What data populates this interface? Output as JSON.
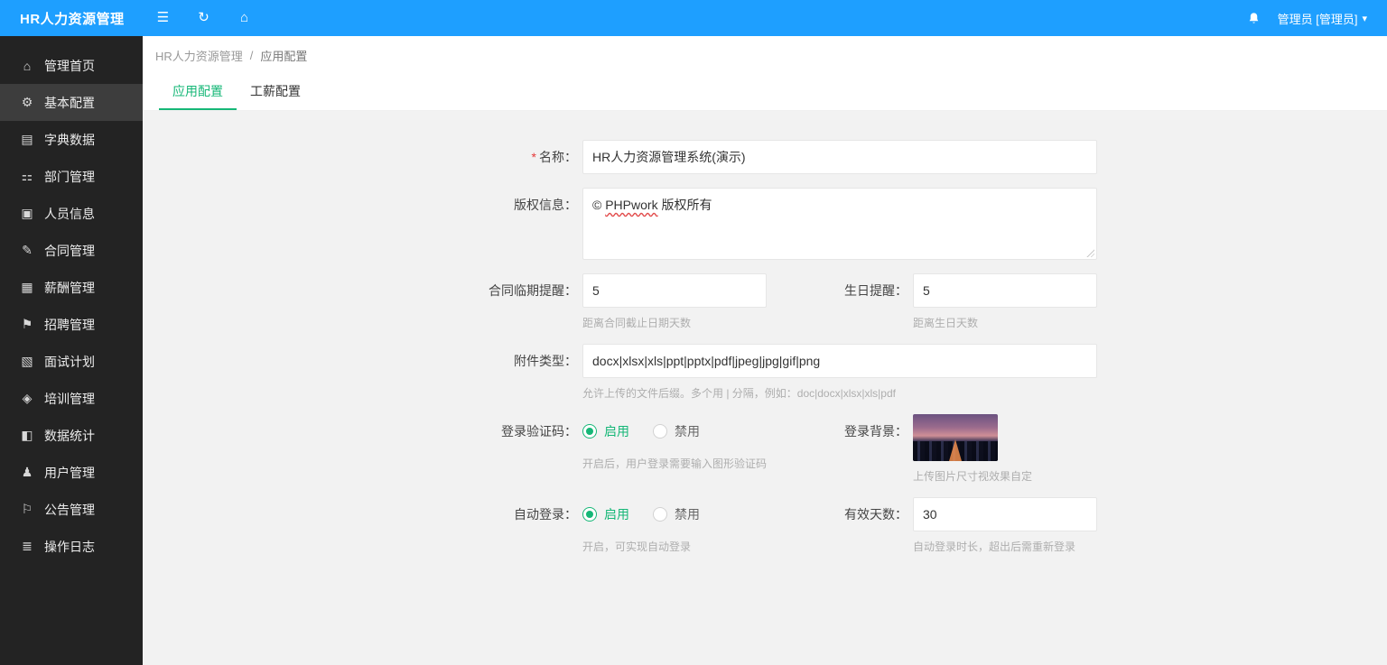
{
  "colors": {
    "primary": "#1e9fff",
    "accent_green": "#16b777",
    "sidebar_bg": "#232323",
    "sidebar_active": "#3d3d3d"
  },
  "header": {
    "title": "HR人力资源管理",
    "icons": {
      "collapse": "☰",
      "refresh": "↻",
      "home": "⌂",
      "caret": "▾"
    },
    "user_label": "管理员 [管理员]"
  },
  "sidebar": {
    "items": [
      {
        "label": "管理首页",
        "icon": "home-icon",
        "glyph": "⌂",
        "active": false
      },
      {
        "label": "基本配置",
        "icon": "settings-gear-icon",
        "glyph": "⚙",
        "active": true
      },
      {
        "label": "字典数据",
        "icon": "dictionary-book-icon",
        "glyph": "▤",
        "active": false
      },
      {
        "label": "部门管理",
        "icon": "department-sitemap-icon",
        "glyph": "⚏",
        "active": false
      },
      {
        "label": "人员信息",
        "icon": "personnel-idcard-icon",
        "glyph": "▣",
        "active": false
      },
      {
        "label": "合同管理",
        "icon": "contract-edit-icon",
        "glyph": "✎",
        "active": false
      },
      {
        "label": "薪酬管理",
        "icon": "salary-calculator-icon",
        "glyph": "▦",
        "active": false
      },
      {
        "label": "招聘管理",
        "icon": "recruitment-megaphone-icon",
        "glyph": "⚑",
        "active": false
      },
      {
        "label": "面试计划",
        "icon": "interview-file-icon",
        "glyph": "▧",
        "active": false
      },
      {
        "label": "培训管理",
        "icon": "training-icon",
        "glyph": "◈",
        "active": false
      },
      {
        "label": "数据统计",
        "icon": "statistics-chart-icon",
        "glyph": "◧",
        "active": false
      },
      {
        "label": "用户管理",
        "icon": "user-icon",
        "glyph": "♟",
        "active": false
      },
      {
        "label": "公告管理",
        "icon": "announcement-speaker-icon",
        "glyph": "⚐",
        "active": false
      },
      {
        "label": "操作日志",
        "icon": "logs-list-icon",
        "glyph": "≣",
        "active": false
      }
    ]
  },
  "breadcrumb": {
    "root": "HR人力资源管理",
    "separator": "/",
    "current": "应用配置"
  },
  "tabs": [
    {
      "label": "应用配置",
      "active": true
    },
    {
      "label": "工薪配置",
      "active": false
    }
  ],
  "form": {
    "name": {
      "required_mark": "*",
      "label": "名称：",
      "value": "HR人力资源管理系统(演示)"
    },
    "copyright": {
      "label": "版权信息：",
      "prefix": "© ",
      "brand": "PHPwork",
      "suffix": " 版权所有"
    },
    "contract_due": {
      "label": "合同临期提醒：",
      "value": "5",
      "hint": "距离合同截止日期天数"
    },
    "birthday": {
      "label": "生日提醒：",
      "value": "5",
      "hint": "距离生日天数"
    },
    "attachment": {
      "label": "附件类型：",
      "value": "docx|xlsx|xls|ppt|pptx|pdf|jpeg|jpg|gif|png",
      "hint": "允许上传的文件后缀。多个用 | 分隔，例如：doc|docx|xlsx|xls|pdf"
    },
    "captcha": {
      "label": "登录验证码：",
      "enabled_label": "启用",
      "disabled_label": "禁用",
      "selected": "启用",
      "hint": "开启后，用户登录需要输入图形验证码"
    },
    "login_bg": {
      "label": "登录背景：",
      "hint": "上传图片尺寸视效果自定"
    },
    "auto_login": {
      "label": "自动登录：",
      "enabled_label": "启用",
      "disabled_label": "禁用",
      "selected": "启用",
      "hint": "开启，可实现自动登录"
    },
    "valid_days": {
      "label": "有效天数：",
      "value": "30",
      "hint": "自动登录时长，超出后需重新登录"
    }
  }
}
